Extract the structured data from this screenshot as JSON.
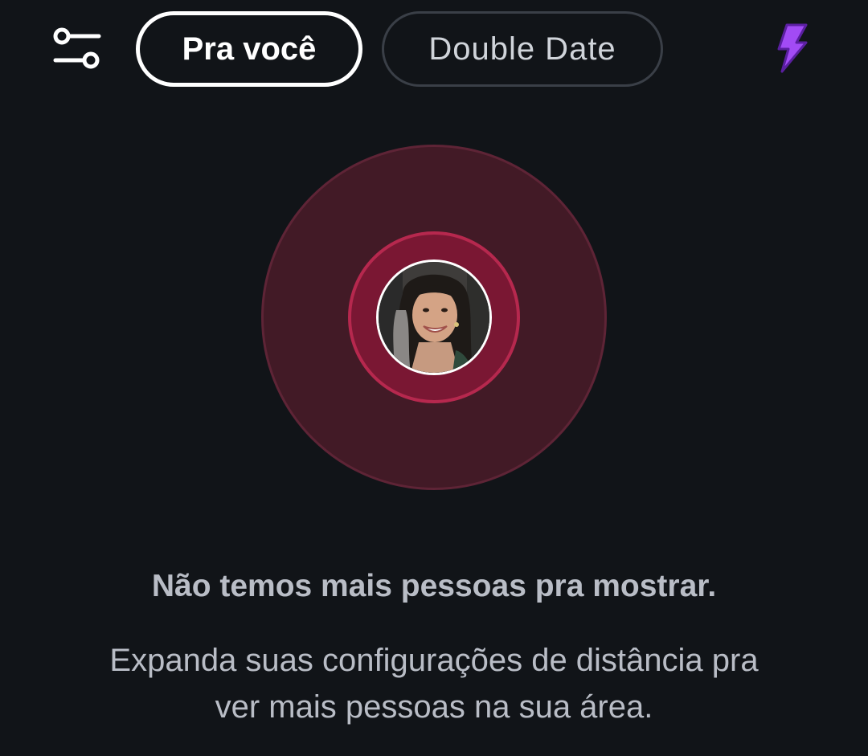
{
  "header": {
    "filter_icon": "sliders-icon",
    "tabs": [
      {
        "label": "Pra você",
        "selected": true
      },
      {
        "label": "Double Date",
        "selected": false
      }
    ],
    "boost_icon": "lightning-bolt-icon",
    "boost_color": "#a24bf5"
  },
  "radar": {
    "outer_color": "#421a26",
    "inner_color": "#7a1733",
    "avatar": "profile-photo"
  },
  "empty_state": {
    "title": "Não temos mais pessoas pra mostrar.",
    "description_line1": "Expanda suas configurações de distância pra",
    "description_line2": "ver mais pessoas na sua área."
  }
}
